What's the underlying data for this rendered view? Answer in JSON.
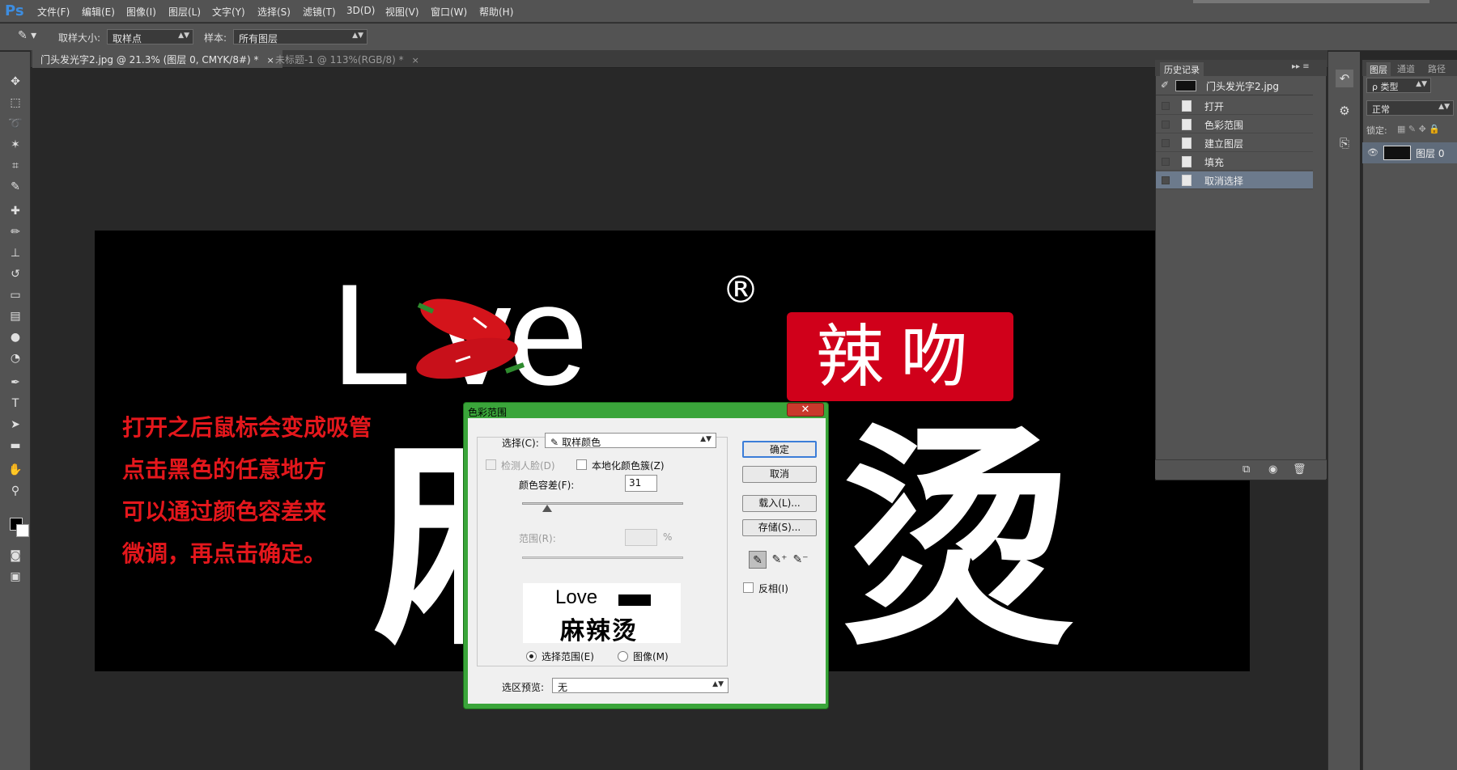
{
  "app": {
    "logo": "Ps",
    "accent": "#3d8de0"
  },
  "menu": [
    "文件(F)",
    "编辑(E)",
    "图像(I)",
    "图层(L)",
    "文字(Y)",
    "选择(S)",
    "滤镜(T)",
    "3D(D)",
    "视图(V)",
    "窗口(W)",
    "帮助(H)"
  ],
  "options": {
    "sample_size_label": "取样大小:",
    "sample_size_value": "取样点",
    "sample_label": "样本:",
    "sample_value": "所有图层"
  },
  "tabs": [
    {
      "label": "门头发光字2.jpg @ 21.3% (图层 0, CMYK/8#) *",
      "close": "×"
    },
    {
      "label": "未标题-1 @ 113%(RGB/8) *",
      "close": "×"
    }
  ],
  "canvas": {
    "logo_word": "L ve",
    "registered": "®",
    "brand": "辣吻",
    "brand_color": "#d0001a",
    "big_left": "麻",
    "big_right": "烫",
    "notes": [
      "打开之后鼠标会变成吸管",
      "点击黑色的任意地方",
      "可以通过颜色容差来",
      "微调，再点击确定。"
    ],
    "note_color": "#e4171c"
  },
  "history": {
    "title": "历史记录",
    "snapshot": "门头发光字2.jpg",
    "items": [
      "打开",
      "色彩范围",
      "建立图层",
      "填充",
      "取消选择"
    ],
    "selected_index": 4
  },
  "layers": {
    "tabs": [
      "图层",
      "通道",
      "路径"
    ],
    "filter_label": "ρ 类型",
    "blend": "正常",
    "lock_label": "锁定:",
    "layer_name": "图层 0"
  },
  "dialog": {
    "title": "色彩范围",
    "close": "✕",
    "select_label": "选择(C):",
    "select_value": "取样颜色",
    "detect_faces": "检测人脸(D)",
    "localized": "本地化颜色簇(Z)",
    "fuzziness_label": "颜色容差(F):",
    "fuzziness_value": "31",
    "fuzziness_fraction": 0.155,
    "range_label": "范围(R):",
    "range_unit": "%",
    "preview_text_top": "Love",
    "preview_text_bottom": "麻辣烫",
    "radio_selection": "选择范围(E)",
    "radio_image": "图像(M)",
    "preview_label": "选区预览:",
    "preview_value": "无",
    "ok": "确定",
    "cancel": "取消",
    "load": "载入(L)...",
    "save": "存储(S)...",
    "invert": "反相(I)"
  }
}
